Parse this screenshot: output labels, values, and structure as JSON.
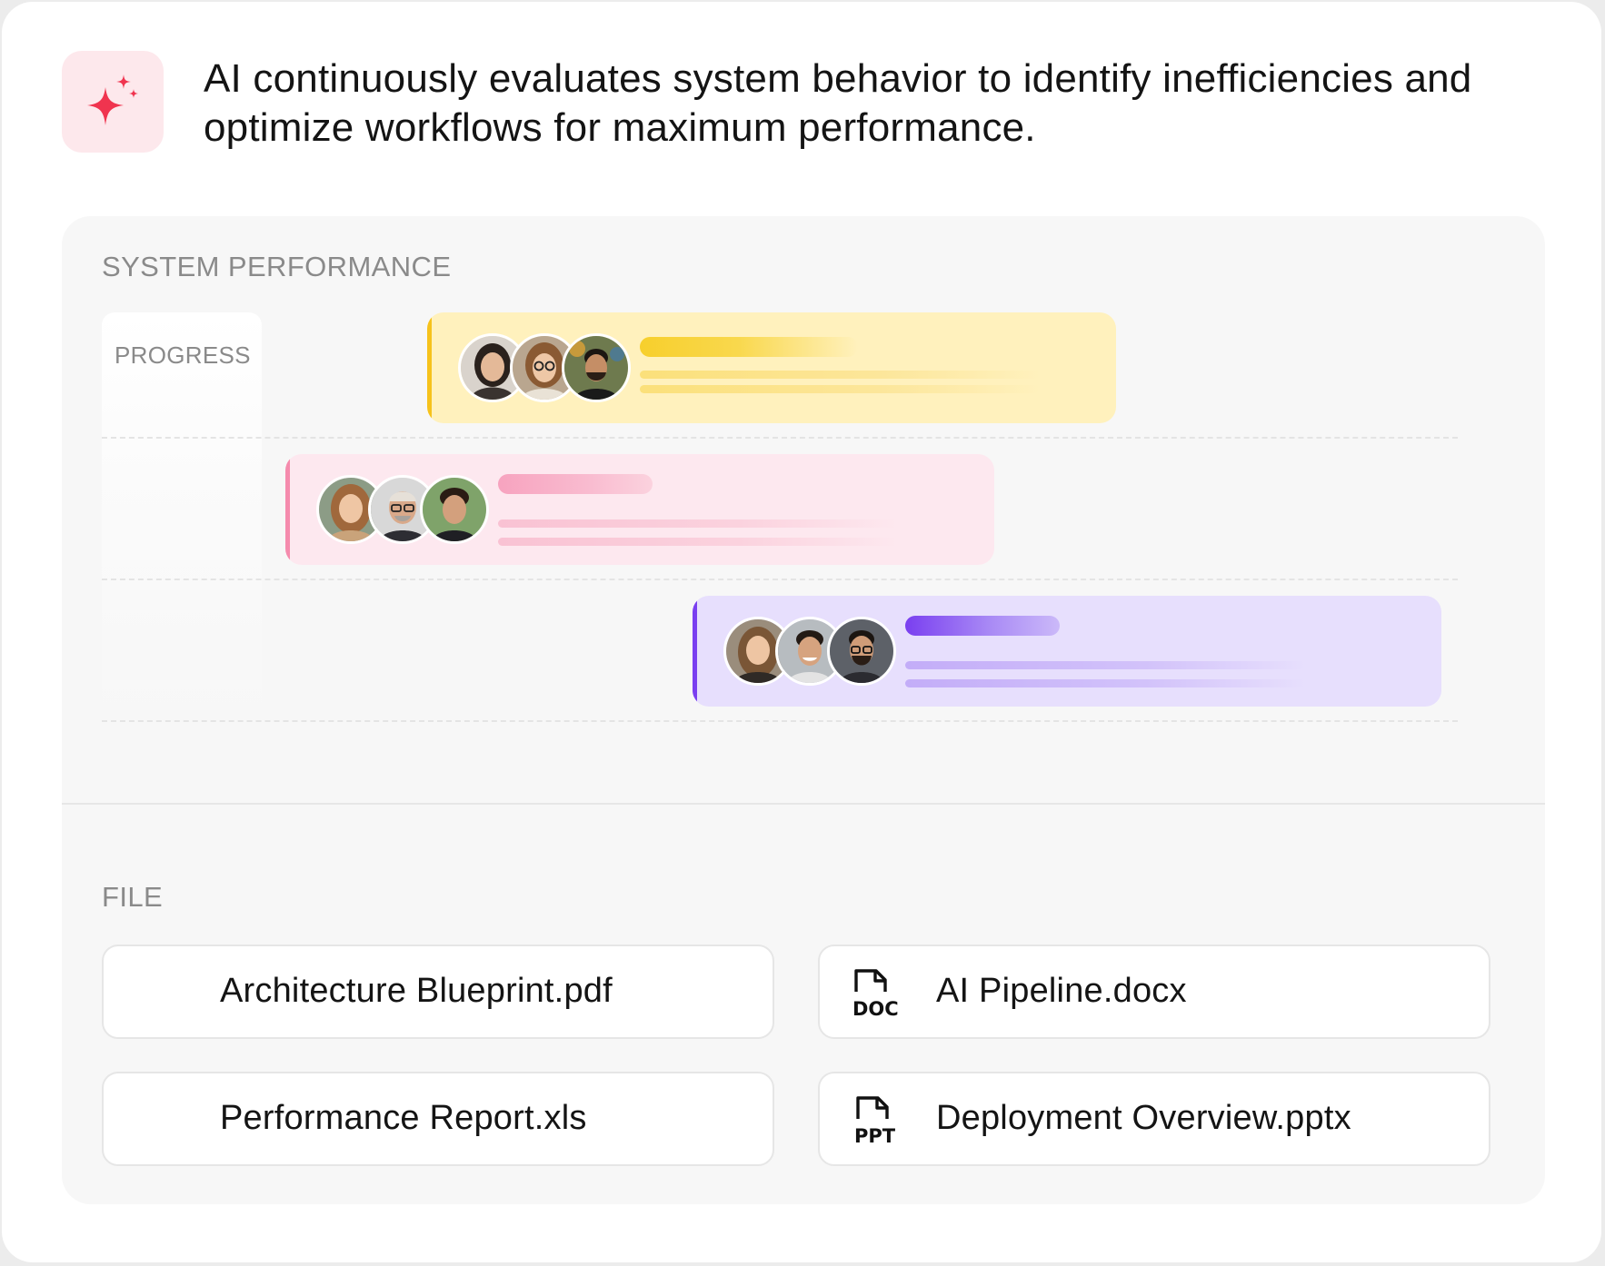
{
  "header": {
    "icon": "sparkle-icon",
    "accent_color": "#f0344f",
    "text": "AI continuously evaluates system behavior to identify inefficiencies and optimize workflows for maximum performance."
  },
  "performance": {
    "title": "SYSTEM PERFORMANCE",
    "column_label": "PROGRESS",
    "tasks": [
      {
        "color": "#f6c21c",
        "progress": 0.22,
        "avatars": [
          "avatar-woman-dark-hair",
          "avatar-woman-glasses",
          "avatar-man-beard"
        ]
      },
      {
        "color": "#f58bad",
        "progress": 0.22,
        "avatars": [
          "avatar-woman-wavy-hair",
          "avatar-man-glasses",
          "avatar-man-curly-hair"
        ]
      },
      {
        "color": "#7a3ff0",
        "progress": 0.21,
        "avatars": [
          "avatar-woman-long-hair",
          "avatar-man-smiling",
          "avatar-man-beard-glasses"
        ]
      }
    ]
  },
  "files": {
    "title": "FILE",
    "items": [
      {
        "name": "Architecture Blueprint.pdf",
        "icon": ""
      },
      {
        "name": "AI Pipeline.docx",
        "icon": "doc-file-icon",
        "icon_text": "DOC"
      },
      {
        "name": "Performance Report.xls",
        "icon": ""
      },
      {
        "name": "Deployment Overview.pptx",
        "icon": "ppt-file-icon",
        "icon_text": "PPT"
      }
    ]
  }
}
